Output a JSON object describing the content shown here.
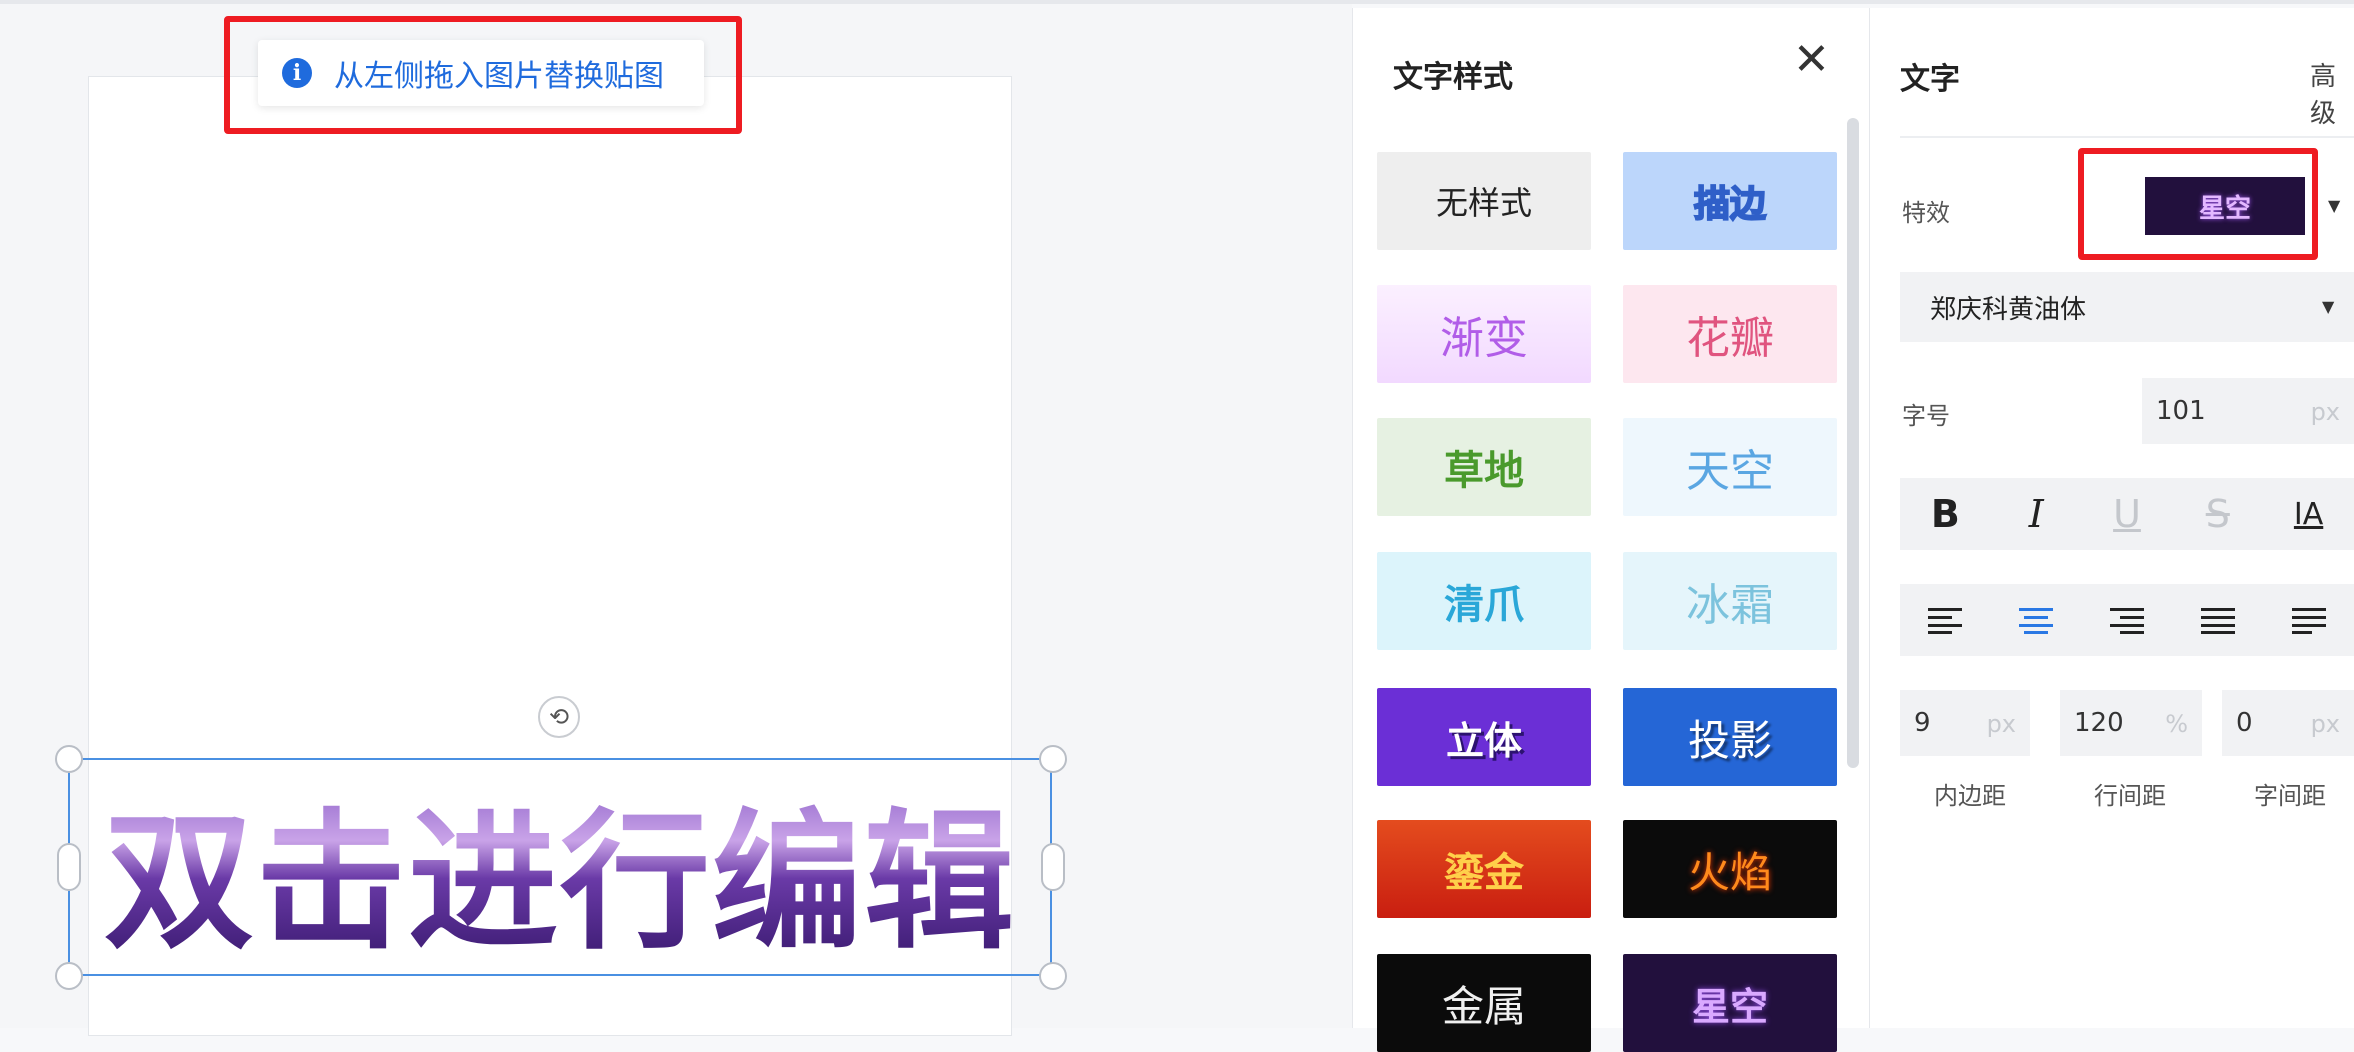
{
  "canvas": {
    "tip_text": "从左侧拖入图片替换贴图",
    "tip_icon": "info-icon",
    "text_content": "双击进行编辑"
  },
  "style_panel": {
    "title": "文字样式",
    "close_icon": "close-icon",
    "styles": [
      {
        "label": "无样式"
      },
      {
        "label": "描边"
      },
      {
        "label": "渐变"
      },
      {
        "label": "花瓣"
      },
      {
        "label": "草地"
      },
      {
        "label": "天空"
      },
      {
        "label": "清爪"
      },
      {
        "label": "冰霜"
      },
      {
        "label": "立体"
      },
      {
        "label": "投影"
      },
      {
        "label": "鎏金"
      },
      {
        "label": "火焰"
      },
      {
        "label": "金属"
      },
      {
        "label": "星空"
      }
    ]
  },
  "props": {
    "title": "文字",
    "advanced_label": "高级",
    "effect_label": "特效",
    "effect_value": "星空",
    "font_family": "郑庆科黄油体",
    "font_size_label": "字号",
    "font_size_value": "101",
    "font_size_unit": "px",
    "format_buttons": {
      "bold": "B",
      "italic": "I",
      "underline": "U",
      "strike": "S",
      "direction": "IA"
    },
    "align_icons": [
      "align-left-icon",
      "align-center-icon",
      "align-right-icon",
      "align-justify-icon",
      "align-distribute-icon"
    ],
    "padding_value": "9",
    "padding_unit": "px",
    "line_height_value": "120",
    "line_height_unit": "%",
    "letter_spacing_value": "0",
    "letter_spacing_unit": "px",
    "padding_label": "内边距",
    "line_height_label": "行间距",
    "letter_spacing_label": "字间距"
  }
}
